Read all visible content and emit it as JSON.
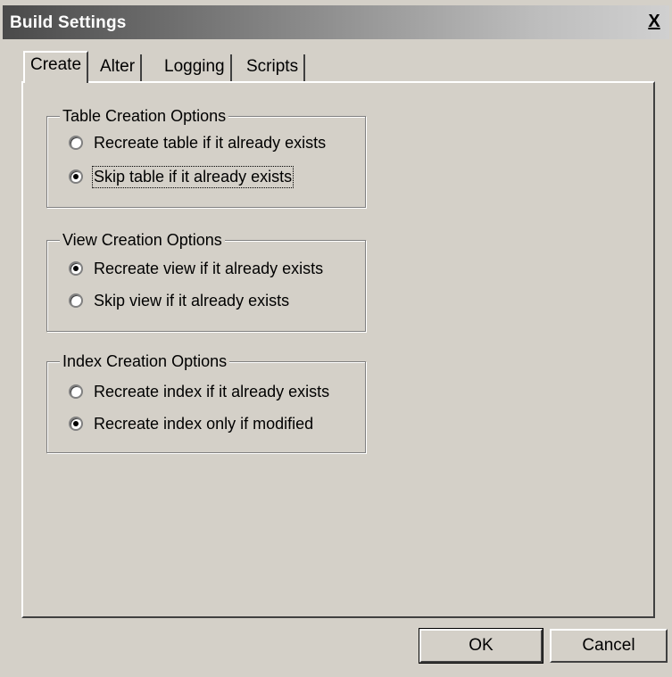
{
  "window": {
    "title": "Build Settings",
    "close_label": "X"
  },
  "tabs": [
    {
      "label": "Create"
    },
    {
      "label": "Alter"
    },
    {
      "label": "Logging"
    },
    {
      "label": "Scripts"
    }
  ],
  "groups": {
    "table": {
      "legend": "Table Creation Options",
      "options": [
        {
          "label": "Recreate table if it already exists",
          "checked": false
        },
        {
          "label": "Skip table if it already exists",
          "checked": true
        }
      ]
    },
    "view": {
      "legend": "View Creation Options",
      "options": [
        {
          "label": "Recreate view if it already exists",
          "checked": true
        },
        {
          "label": "Skip view if it already exists",
          "checked": false
        }
      ]
    },
    "index": {
      "legend": "Index Creation Options",
      "options": [
        {
          "label": "Recreate index if it already exists",
          "checked": false
        },
        {
          "label": "Recreate index only if modified",
          "checked": true
        }
      ]
    }
  },
  "buttons": {
    "ok_label": "OK",
    "cancel_label": "Cancel"
  }
}
